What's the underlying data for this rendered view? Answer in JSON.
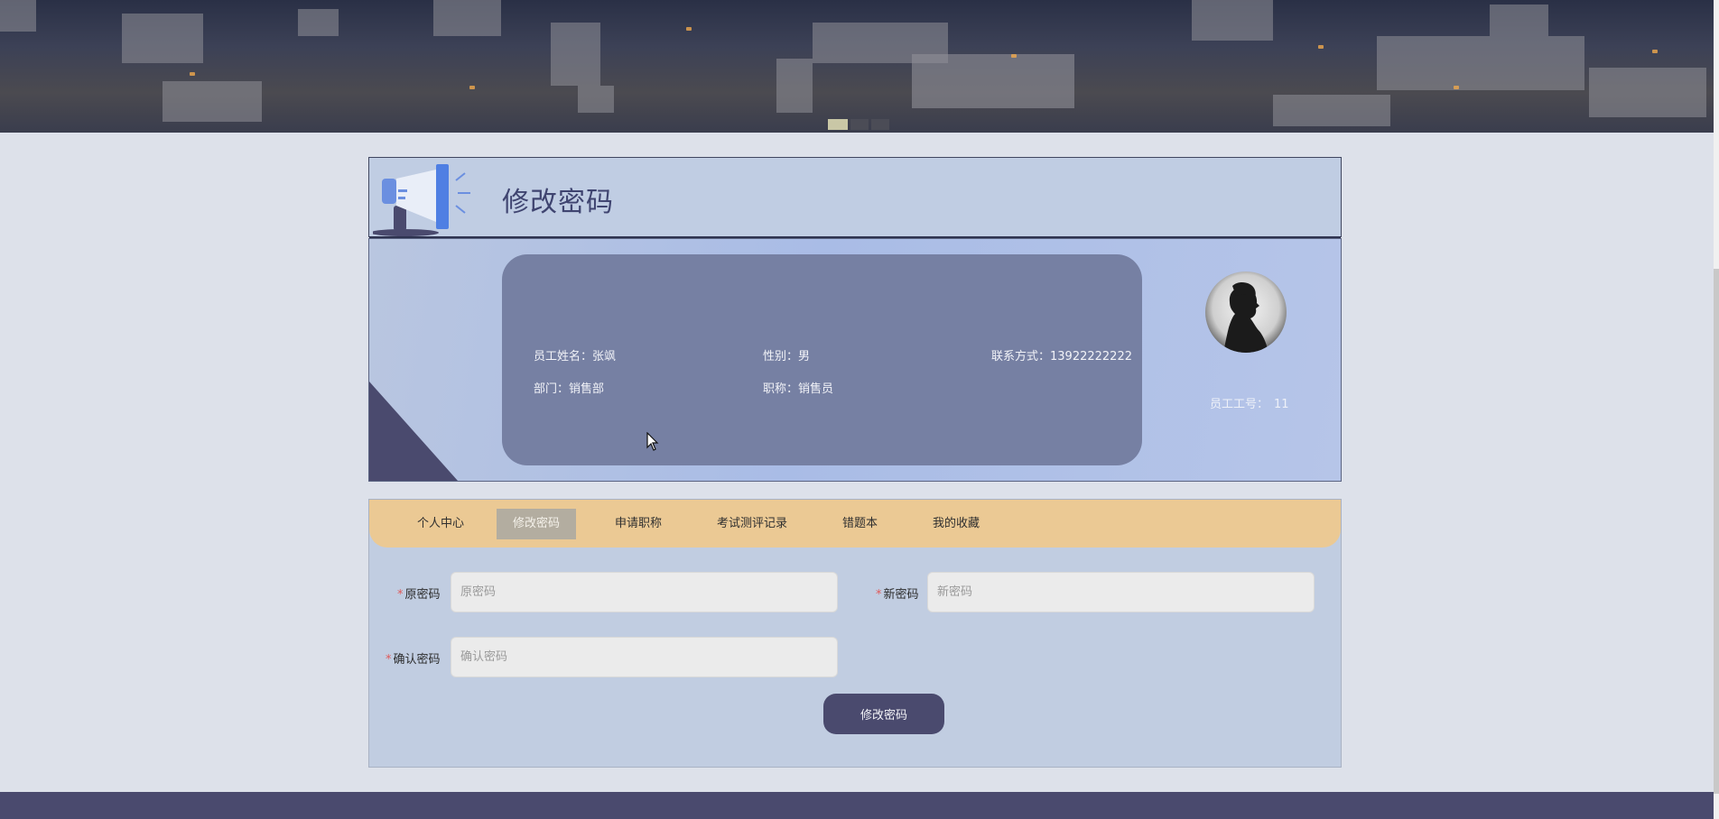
{
  "page": {
    "title": "修改密码"
  },
  "banner": {
    "slides": 3,
    "active_slide": 1
  },
  "profile": {
    "name_label": "员工姓名：",
    "name": "张飒",
    "gender_label": "性别：",
    "gender": "男",
    "phone_label": "联系方式：",
    "phone": "13922222222",
    "dept_label": "部门：",
    "dept": "销售部",
    "position_label": "职称：",
    "position": "销售员",
    "emp_no_label": "员工工号：",
    "emp_no": "11"
  },
  "tabs": [
    {
      "label": "个人中心",
      "active": false
    },
    {
      "label": "修改密码",
      "active": true
    },
    {
      "label": "申请职称",
      "active": false
    },
    {
      "label": "考试测评记录",
      "active": false
    },
    {
      "label": "错题本",
      "active": false
    },
    {
      "label": "我的收藏",
      "active": false
    }
  ],
  "form": {
    "required_mark": "*",
    "old_password": {
      "label": "原密码",
      "placeholder": "原密码",
      "value": ""
    },
    "new_password": {
      "label": "新密码",
      "placeholder": "新密码",
      "value": ""
    },
    "confirm_password": {
      "label": "确认密码",
      "placeholder": "确认密码",
      "value": ""
    },
    "submit_label": "修改密码"
  },
  "colors": {
    "primary": "#4a4a6e",
    "tabbar": "#ebc994",
    "active_tab": "#b3ada0",
    "required": "#e05a5a"
  },
  "icons": {
    "header": "megaphone-icon",
    "avatar": "user-silhouette-icon"
  }
}
